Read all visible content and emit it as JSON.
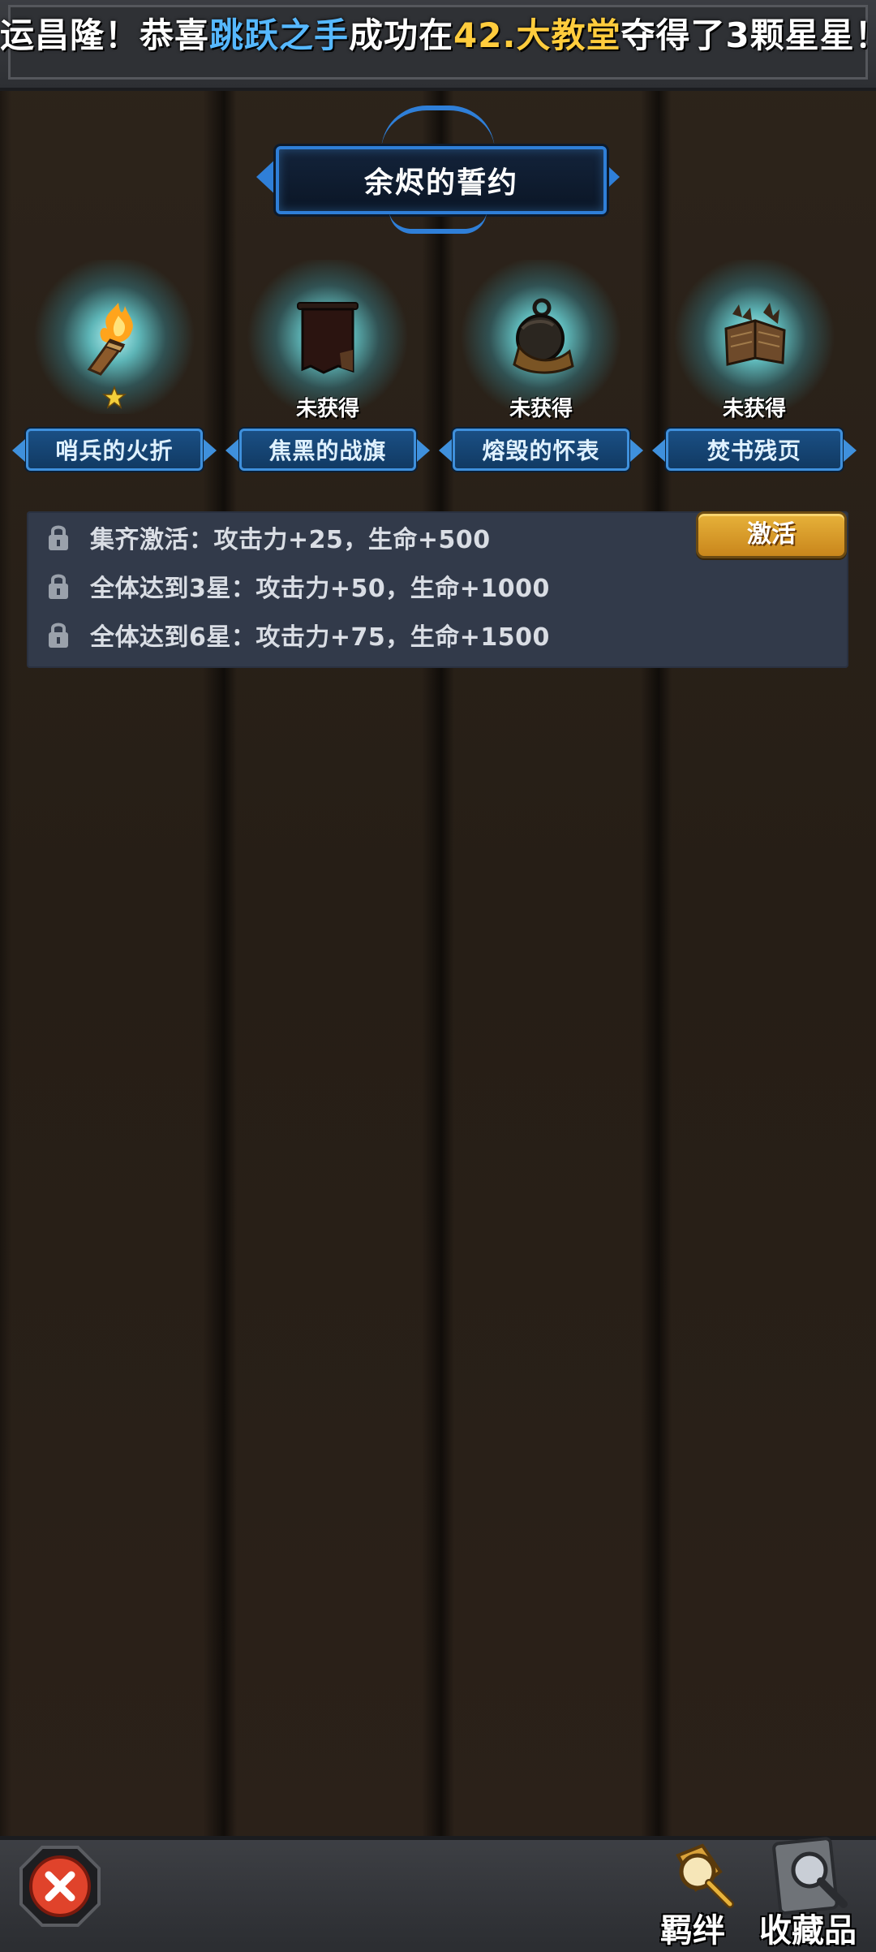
{
  "banner": {
    "part1": "运昌隆！恭喜",
    "player": "跳跃之手",
    "part2": "成功在",
    "stage": "42.大教堂",
    "part3": "夺得了3颗星星！"
  },
  "title": "余烬的誓约",
  "items": [
    {
      "name": "哨兵的火折",
      "status": "",
      "icon": "torch-icon"
    },
    {
      "name": "焦黑的战旗",
      "status": "未获得",
      "icon": "banner-icon"
    },
    {
      "name": "熔毁的怀表",
      "status": "未获得",
      "icon": "pocket-watch-icon"
    },
    {
      "name": "焚书残页",
      "status": "未获得",
      "icon": "burnt-book-icon"
    }
  ],
  "bonuses": [
    {
      "text": "集齐激活：攻击力+25，生命+500"
    },
    {
      "text": "全体达到3星：攻击力+50，生命+1000"
    },
    {
      "text": "全体达到6星：攻击力+75，生命+1500"
    }
  ],
  "activate_label": "激活",
  "nav": {
    "bond_label": "羁绊",
    "collection_label": "收藏品"
  },
  "colors": {
    "accent_blue": "#2f7fd8",
    "gold": "#e7b23a",
    "panel": "#323a4a",
    "close_red": "#e0432b"
  }
}
